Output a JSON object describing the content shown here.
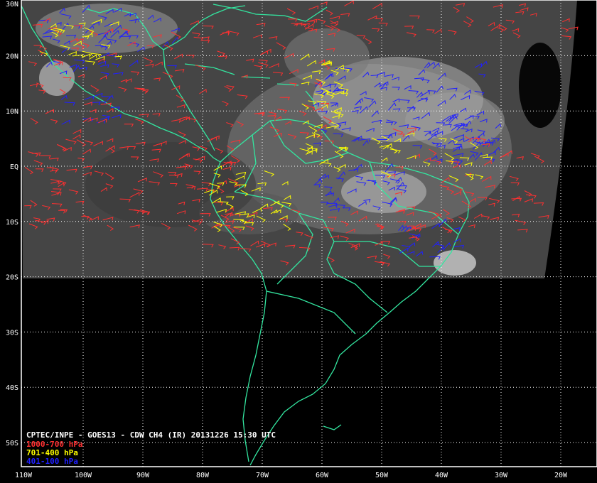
{
  "title": "CPTEC/INPE - GOES13 - CDW CH4 (IR) 20131226 15:30 UTC",
  "colors": {
    "background": "#000000",
    "frame": "#ffffff",
    "grid": "#ffffff",
    "coast": "#33e6a0",
    "satellite": "#4a4a4a",
    "cloud": "#c8c8c8"
  },
  "axes": {
    "lon_labels": [
      {
        "lon": -110,
        "label": "110W"
      },
      {
        "lon": -100,
        "label": "100W"
      },
      {
        "lon": -90,
        "label": "90W"
      },
      {
        "lon": -80,
        "label": "80W"
      },
      {
        "lon": -70,
        "label": "70W"
      },
      {
        "lon": -60,
        "label": "60W"
      },
      {
        "lon": -50,
        "label": "50W"
      },
      {
        "lon": -40,
        "label": "40W"
      },
      {
        "lon": -30,
        "label": "30W"
      },
      {
        "lon": -20,
        "label": "20W"
      }
    ],
    "lat_labels": [
      {
        "lat": 30,
        "label": "30N"
      },
      {
        "lat": 20,
        "label": "20N"
      },
      {
        "lat": 10,
        "label": "10N"
      },
      {
        "lat": 0,
        "label": "EQ"
      },
      {
        "lat": -10,
        "label": "10S"
      },
      {
        "lat": -20,
        "label": "20S"
      },
      {
        "lat": -30,
        "label": "30S"
      },
      {
        "lat": -40,
        "label": "40S"
      },
      {
        "lat": -50,
        "label": "50S"
      }
    ],
    "grid": "dotted"
  },
  "legend": [
    {
      "label": "1000-700 hPa",
      "color": "#ff3030"
    },
    {
      "label": "701-400 hPa",
      "color": "#ffff00"
    },
    {
      "label": "401-100 hPa",
      "color": "#2020ff"
    }
  ]
}
